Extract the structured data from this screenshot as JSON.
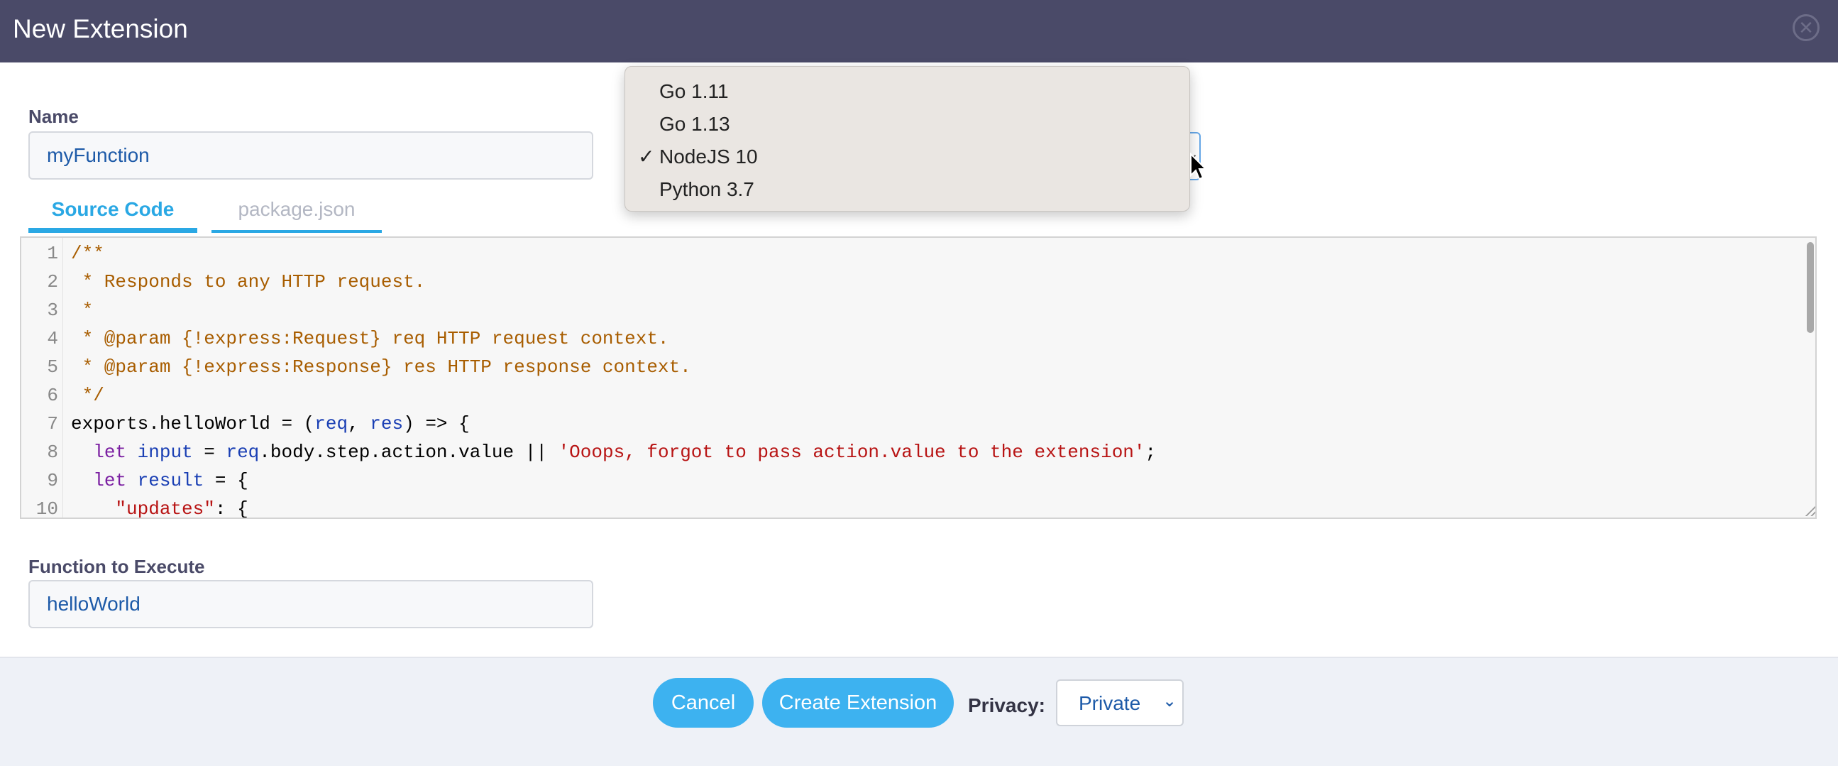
{
  "dialog": {
    "title": "New Extension",
    "close_icon": "close-icon"
  },
  "name_field": {
    "label": "Name",
    "value": "myFunction"
  },
  "runtime": {
    "selected": "NodeJS 10",
    "options": [
      {
        "label": "Go 1.11",
        "checked": false
      },
      {
        "label": "Go 1.13",
        "checked": false
      },
      {
        "label": "NodeJS 10",
        "checked": true
      },
      {
        "label": "Python 3.7",
        "checked": false
      }
    ],
    "check_mark": "✓"
  },
  "tabs": [
    {
      "label": "Source Code",
      "active": true
    },
    {
      "label": "package.json",
      "active": false
    }
  ],
  "code": {
    "lines": [
      {
        "n": "1",
        "tokens": [
          {
            "t": "/**",
            "c": "comment"
          }
        ]
      },
      {
        "n": "2",
        "tokens": [
          {
            "t": " * Responds to any HTTP request.",
            "c": "comment"
          }
        ]
      },
      {
        "n": "3",
        "tokens": [
          {
            "t": " *",
            "c": "comment"
          }
        ]
      },
      {
        "n": "4",
        "tokens": [
          {
            "t": " * @param {!express:Request} req HTTP request context.",
            "c": "comment"
          }
        ]
      },
      {
        "n": "5",
        "tokens": [
          {
            "t": " * @param {!express:Response} res HTTP response context.",
            "c": "comment"
          }
        ]
      },
      {
        "n": "6",
        "tokens": [
          {
            "t": " */",
            "c": "comment"
          }
        ]
      },
      {
        "n": "7",
        "tokens": [
          {
            "t": "exports.helloWorld = (",
            "c": "plain"
          },
          {
            "t": "req",
            "c": "var"
          },
          {
            "t": ", ",
            "c": "plain"
          },
          {
            "t": "res",
            "c": "var"
          },
          {
            "t": ") => {",
            "c": "plain"
          }
        ]
      },
      {
        "n": "8",
        "tokens": [
          {
            "t": "  ",
            "c": "plain"
          },
          {
            "t": "let",
            "c": "keyword"
          },
          {
            "t": " ",
            "c": "plain"
          },
          {
            "t": "input",
            "c": "var"
          },
          {
            "t": " = ",
            "c": "plain"
          },
          {
            "t": "req",
            "c": "var"
          },
          {
            "t": ".body.step.action.value || ",
            "c": "plain"
          },
          {
            "t": "'Ooops, forgot to pass action.value to the extension'",
            "c": "string"
          },
          {
            "t": ";",
            "c": "plain"
          }
        ]
      },
      {
        "n": "9",
        "tokens": [
          {
            "t": "  ",
            "c": "plain"
          },
          {
            "t": "let",
            "c": "keyword"
          },
          {
            "t": " ",
            "c": "plain"
          },
          {
            "t": "result",
            "c": "var"
          },
          {
            "t": " = {",
            "c": "plain"
          }
        ]
      },
      {
        "n": "10",
        "tokens": [
          {
            "t": "    ",
            "c": "plain"
          },
          {
            "t": "\"updates\"",
            "c": "string"
          },
          {
            "t": ": {",
            "c": "plain"
          }
        ]
      }
    ]
  },
  "function_field": {
    "label": "Function to Execute",
    "value": "helloWorld"
  },
  "footer": {
    "cancel_label": "Cancel",
    "create_label": "Create Extension",
    "privacy_label": "Privacy:",
    "privacy_value": "Private"
  },
  "colors": {
    "header": "#4a4a68",
    "accent": "#3db2f0",
    "tab_active": "#2aa8e4",
    "comment": "#a85d00",
    "keyword": "#7b1fa2",
    "variable": "#1a3fb4",
    "string": "#b81414"
  }
}
